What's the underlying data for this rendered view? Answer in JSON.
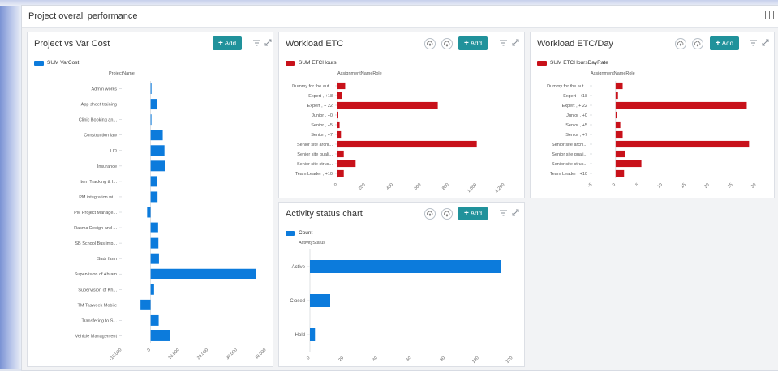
{
  "dashboard": {
    "title": "Project overall performance"
  },
  "colors": {
    "blue": "#0c7bdc",
    "red": "#c8111a",
    "teal": "#20929b"
  },
  "panels": {
    "p1": {
      "title": "Project vs Var Cost",
      "add_label": "Add",
      "legend": "SUM VarCost",
      "field": "ProjectName"
    },
    "p2": {
      "title": "Workload ETC",
      "add_label": "Add",
      "legend": "SUM ETCHours",
      "field": "AssignmentNameRole"
    },
    "p3": {
      "title": "Workload ETC/Day",
      "add_label": "Add",
      "legend": "SUM ETCHoursDayRate",
      "field": "AssignmentNameRole"
    },
    "p4": {
      "title": "Activity status chart",
      "add_label": "Add",
      "legend": "Count",
      "field": "ActivityStatus"
    }
  },
  "chart_data": [
    {
      "type": "bar",
      "orientation": "horizontal",
      "title": "Project vs Var Cost",
      "legend": "SUM VarCost",
      "ylabel": "ProjectName",
      "categories": [
        "Admin works",
        "App sheet training",
        "Clinic Booking an...",
        "Construction law",
        "HR",
        "Insurance",
        "Item Tracking & I...",
        "PM integration wi...",
        "PM Project Manage...",
        "Rasma Design and ...",
        "SB School Bus imp...",
        "Sadr farm",
        "Supervision of Ahram",
        "Supervision of Kh...",
        "TM Tasweek Mobile",
        "Transfering to S...",
        "Vehicle Management"
      ],
      "values": [
        300,
        2200,
        0,
        4200,
        4800,
        5100,
        2100,
        2400,
        -1200,
        2600,
        2700,
        2900,
        36500,
        1200,
        -3500,
        2800,
        6800
      ],
      "xlim": [
        -10000,
        40000
      ],
      "ticks": [
        -10000,
        0,
        10000,
        20000,
        30000,
        40000
      ],
      "tick_labels": [
        "-10,000",
        "0",
        "10,000",
        "20,000",
        "30,000",
        "40,000"
      ]
    },
    {
      "type": "bar",
      "orientation": "horizontal",
      "title": "Workload ETC",
      "legend": "SUM ETCHours",
      "ylabel": "AssignmentNameRole",
      "categories": [
        "Dummy for the aut...",
        "Expert , +18",
        "Expert , + 22",
        "Junior , +0",
        "Senior , +5",
        "Senior , +7",
        "Senior site archi...",
        "Senior site quali...",
        "Senior site struc...",
        "Team Leader , +10"
      ],
      "values": [
        55,
        30,
        720,
        5,
        15,
        25,
        1000,
        45,
        130,
        45
      ],
      "xlim": [
        0,
        1200
      ],
      "ticks": [
        0,
        200,
        400,
        600,
        800,
        1000,
        1200
      ],
      "tick_labels": [
        "0",
        "200",
        "400",
        "600",
        "800",
        "1,000",
        "1,200"
      ]
    },
    {
      "type": "bar",
      "orientation": "horizontal",
      "title": "Workload ETC/Day",
      "legend": "SUM ETCHoursDayRate",
      "ylabel": "AssignmentNameRole",
      "categories": [
        "Dummy for the aut...",
        "Expert , +18",
        "Expert , + 22",
        "Junior , +0",
        "Senior , +5",
        "Senior , +7",
        "Senior site archi...",
        "Senior site quali...",
        "Senior site struc...",
        "Team Leader , +10"
      ],
      "values": [
        1.5,
        0.5,
        28,
        0.3,
        1,
        1.5,
        28.5,
        2,
        5.5,
        1.8
      ],
      "xlim": [
        -5,
        30
      ],
      "ticks": [
        -5,
        0,
        5,
        10,
        15,
        20,
        25,
        30
      ],
      "tick_labels": [
        "-5",
        "0",
        "5",
        "10",
        "15",
        "20",
        "25",
        "30"
      ]
    },
    {
      "type": "bar",
      "orientation": "horizontal",
      "title": "Activity status chart",
      "legend": "Count",
      "ylabel": "ActivityStatus",
      "categories": [
        "Active",
        "Closed",
        "Hold"
      ],
      "values": [
        113,
        12,
        3
      ],
      "xlim": [
        0,
        120
      ],
      "ticks": [
        0,
        20,
        40,
        60,
        80,
        100,
        120
      ],
      "tick_labels": [
        "0",
        "20",
        "40",
        "60",
        "80",
        "100",
        "120"
      ]
    }
  ]
}
